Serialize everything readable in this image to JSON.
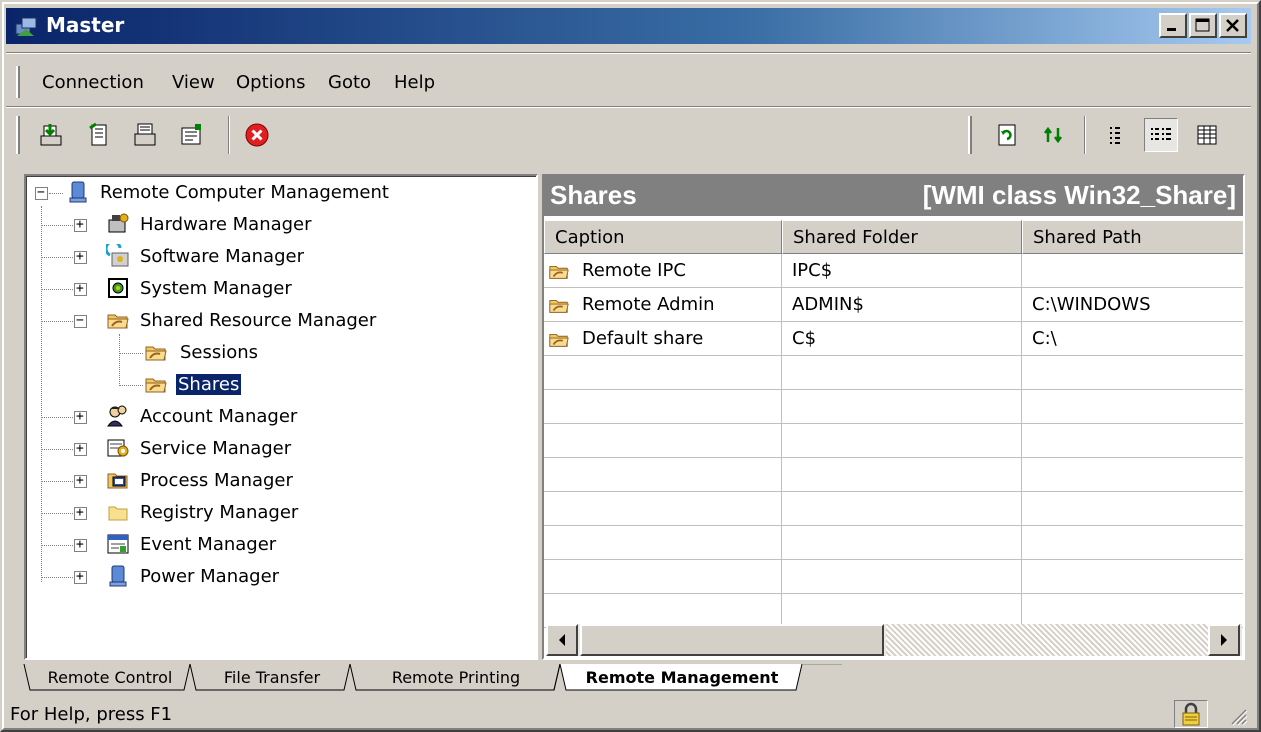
{
  "window": {
    "title": "Master"
  },
  "menu": [
    "Connection",
    "View",
    "Options",
    "Goto",
    "Help"
  ],
  "toolbar": {
    "left_buttons": [
      "connect-icon",
      "disconnect-icon",
      "properties-icon",
      "network-icon",
      "stop-icon"
    ],
    "right_buttons": [
      "refresh-icon",
      "swap-icon",
      "small-icons-icon",
      "list-icon",
      "details-icon"
    ]
  },
  "tree": {
    "root": "Remote Computer Management",
    "items": [
      {
        "label": "Hardware Manager",
        "expander": "+"
      },
      {
        "label": "Software Manager",
        "expander": "+"
      },
      {
        "label": "System Manager",
        "expander": "+"
      },
      {
        "label": "Shared Resource Manager",
        "expander": "−"
      },
      {
        "label": "Sessions"
      },
      {
        "label": "Shares",
        "selected": true
      },
      {
        "label": "Account Manager",
        "expander": "+"
      },
      {
        "label": "Service Manager",
        "expander": "+"
      },
      {
        "label": "Process Manager",
        "expander": "+"
      },
      {
        "label": "Registry Manager",
        "expander": "+"
      },
      {
        "label": "Event Manager",
        "expander": "+"
      },
      {
        "label": "Power Manager",
        "expander": "+"
      }
    ]
  },
  "pane": {
    "title": "Shares",
    "subtitle": "[WMI class Win32_Share]",
    "columns": [
      "Caption",
      "Shared Folder",
      "Shared Path"
    ],
    "rows": [
      [
        "Remote IPC",
        "IPC$",
        ""
      ],
      [
        "Remote Admin",
        "ADMIN$",
        "C:\\WINDOWS"
      ],
      [
        "Default share",
        "C$",
        "C:\\"
      ]
    ]
  },
  "tabs": [
    "Remote Control",
    "File Transfer",
    "Remote Printing",
    "Remote Management"
  ],
  "active_tab": "Remote Management",
  "status": {
    "text": "For Help, press F1"
  },
  "colors": {
    "title_start": "#0a246a",
    "title_end": "#a6caf0",
    "selection": "#0a246a",
    "face": "#d4d0c8",
    "pane_header": "#808080"
  }
}
